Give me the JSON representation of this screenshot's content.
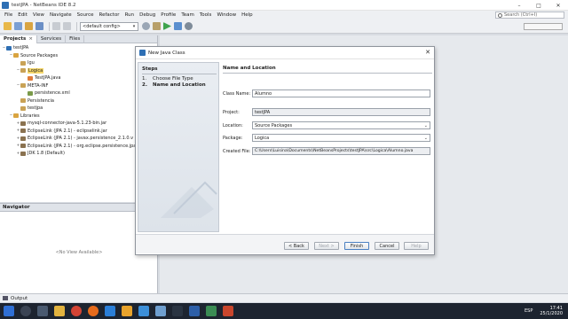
{
  "window": {
    "title": "testJPA - NetBeans IDE 8.2",
    "controls": [
      "–",
      "□",
      "✕"
    ]
  },
  "menu": {
    "items": [
      "File",
      "Edit",
      "View",
      "Navigate",
      "Source",
      "Refactor",
      "Run",
      "Debug",
      "Profile",
      "Team",
      "Tools",
      "Window",
      "Help"
    ],
    "search_placeholder": "Search (Ctrl+I)"
  },
  "toolbar": {
    "config": "<default config>"
  },
  "projects_panel": {
    "tabs": [
      "Projects",
      "Services",
      "Files"
    ],
    "tree": [
      {
        "label": "testJPA",
        "depth": 0,
        "exp": "−",
        "icon": "project"
      },
      {
        "label": "Source Packages",
        "depth": 1,
        "exp": "−",
        "icon": "folder"
      },
      {
        "label": "Igu",
        "depth": 2,
        "exp": "",
        "icon": "package"
      },
      {
        "label": "Logica",
        "depth": 2,
        "exp": "−",
        "icon": "package",
        "selected": true
      },
      {
        "label": "TestJPA.java",
        "depth": 3,
        "exp": "",
        "icon": "java"
      },
      {
        "label": "META-INF",
        "depth": 2,
        "exp": "−",
        "icon": "package"
      },
      {
        "label": "persistence.xml",
        "depth": 3,
        "exp": "",
        "icon": "xml"
      },
      {
        "label": "Persistencia",
        "depth": 2,
        "exp": "",
        "icon": "package"
      },
      {
        "label": "testjpa",
        "depth": 2,
        "exp": "",
        "icon": "package"
      },
      {
        "label": "Libraries",
        "depth": 1,
        "exp": "−",
        "icon": "folder"
      },
      {
        "label": "mysql-connector-java-5.1.23-bin.jar",
        "depth": 2,
        "exp": "+",
        "icon": "jar"
      },
      {
        "label": "EclipseLink (JPA 2.1) - eclipselink.jar",
        "depth": 2,
        "exp": "+",
        "icon": "jar"
      },
      {
        "label": "EclipseLink (JPA 2.1) - javax.persistence_2.1.0.v",
        "depth": 2,
        "exp": "+",
        "icon": "jar"
      },
      {
        "label": "EclipseLink (JPA 2.1) - org.eclipse.persistence.jpa",
        "depth": 2,
        "exp": "+",
        "icon": "jar"
      },
      {
        "label": "JDK 1.8 (Default)",
        "depth": 2,
        "exp": "+",
        "icon": "jar"
      }
    ]
  },
  "navigator": {
    "tab": "Navigator",
    "empty_text": "<No View Available>"
  },
  "output": {
    "label": "Output"
  },
  "dialog": {
    "title": "New Java Class",
    "steps_heading": "Steps",
    "steps": [
      {
        "num": "1.",
        "label": "Choose File Type"
      },
      {
        "num": "2.",
        "label": "Name and Location"
      }
    ],
    "content_heading": "Name and Location",
    "fields": {
      "class_name": {
        "label": "Class Name:",
        "value": "Alumno"
      },
      "project": {
        "label": "Project:",
        "value": "testJPA"
      },
      "location": {
        "label": "Location:",
        "value": "Source Packages"
      },
      "package": {
        "label": "Package:",
        "value": "Logica"
      },
      "created_file": {
        "label": "Created File:",
        "value": "C:\\Users\\Luisina\\Documents\\NetBeansProjects\\testJPA\\src\\Logica\\Alumno.java"
      }
    },
    "buttons": {
      "back": "< Back",
      "next": "Next >",
      "finish": "Finish",
      "cancel": "Cancel",
      "help": "Help"
    }
  },
  "taskbar": {
    "lang": "ESP",
    "time": "17:41",
    "date": "25/1/2020"
  },
  "colors": {
    "accent": "#2e6fb4",
    "selection": "#f6d76a",
    "taskbar": "#1d2430"
  }
}
